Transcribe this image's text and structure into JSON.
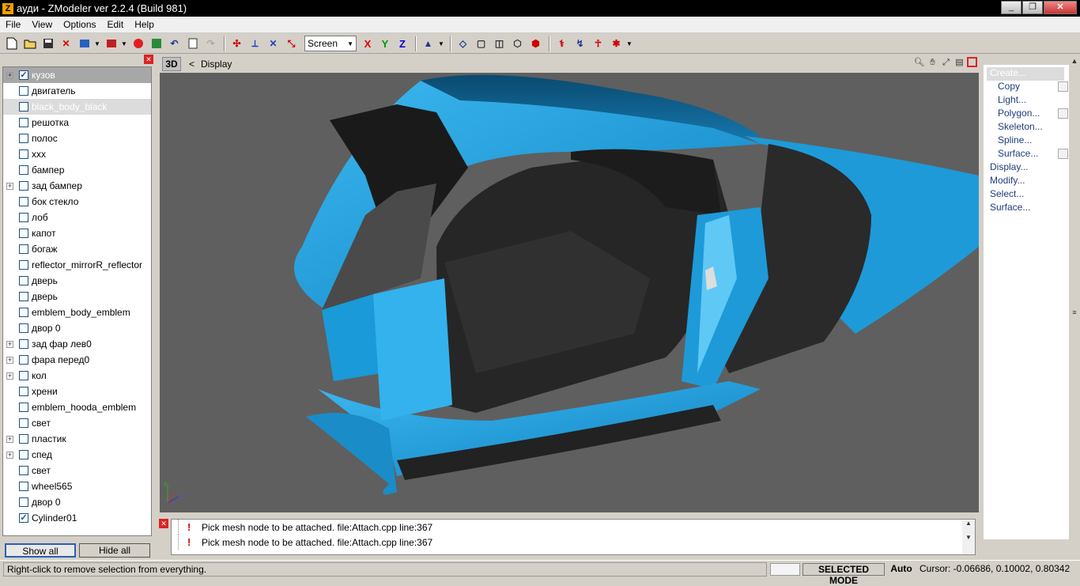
{
  "window": {
    "title": "ауди - ZModeler ver 2.2.4 (Build 981)",
    "app_icon": "Z"
  },
  "menu": [
    "File",
    "View",
    "Options",
    "Edit",
    "Help"
  ],
  "toolbar": {
    "view_mode": "Screen",
    "axis_x": "X",
    "axis_y": "Y",
    "axis_z": "Z"
  },
  "tree": {
    "items": [
      {
        "label": "кузов",
        "expandable": true,
        "checked": true,
        "state": "selected"
      },
      {
        "label": "двигатель",
        "expandable": false,
        "checked": false,
        "state": ""
      },
      {
        "label": "black_body_black",
        "expandable": false,
        "checked": false,
        "state": "highlight"
      },
      {
        "label": "решотка",
        "expandable": false,
        "checked": false,
        "state": ""
      },
      {
        "label": "полос",
        "expandable": false,
        "checked": false,
        "state": ""
      },
      {
        "label": "xxx",
        "expandable": false,
        "checked": false,
        "state": ""
      },
      {
        "label": "бампер",
        "expandable": false,
        "checked": false,
        "state": ""
      },
      {
        "label": "зад бампер",
        "expandable": true,
        "checked": false,
        "state": ""
      },
      {
        "label": "бок стекло",
        "expandable": false,
        "checked": false,
        "state": ""
      },
      {
        "label": "лоб",
        "expandable": false,
        "checked": false,
        "state": ""
      },
      {
        "label": "капот",
        "expandable": false,
        "checked": false,
        "state": ""
      },
      {
        "label": "богаж",
        "expandable": false,
        "checked": false,
        "state": ""
      },
      {
        "label": "reflector_mirrorR_reflector",
        "expandable": false,
        "checked": false,
        "state": ""
      },
      {
        "label": "дверь",
        "expandable": false,
        "checked": false,
        "state": ""
      },
      {
        "label": "дверь",
        "expandable": false,
        "checked": false,
        "state": ""
      },
      {
        "label": "emblem_body_emblem",
        "expandable": false,
        "checked": false,
        "state": ""
      },
      {
        "label": "двор 0",
        "expandable": false,
        "checked": false,
        "state": ""
      },
      {
        "label": "зад фар лев0",
        "expandable": true,
        "checked": false,
        "state": ""
      },
      {
        "label": "фара перед0",
        "expandable": true,
        "checked": false,
        "state": ""
      },
      {
        "label": "кол",
        "expandable": true,
        "checked": false,
        "state": ""
      },
      {
        "label": "хрени",
        "expandable": false,
        "checked": false,
        "state": ""
      },
      {
        "label": "emblem_hooda_emblem",
        "expandable": false,
        "checked": false,
        "state": ""
      },
      {
        "label": "свет",
        "expandable": false,
        "checked": false,
        "state": ""
      },
      {
        "label": "пластик",
        "expandable": true,
        "checked": false,
        "state": ""
      },
      {
        "label": "спед",
        "expandable": true,
        "checked": false,
        "state": ""
      },
      {
        "label": "свет",
        "expandable": false,
        "checked": false,
        "state": ""
      },
      {
        "label": "wheel565",
        "expandable": false,
        "checked": false,
        "state": ""
      },
      {
        "label": "двор 0",
        "expandable": false,
        "checked": false,
        "state": ""
      },
      {
        "label": "Cylinder01",
        "expandable": false,
        "checked": true,
        "state": ""
      }
    ],
    "show_all": "Show all",
    "hide_all": "Hide all"
  },
  "viewport": {
    "mode": "3D",
    "chevron": "<",
    "label": "Display",
    "axis_labels": {
      "y": "y",
      "z": "z"
    }
  },
  "log": [
    "Pick mesh node to be attached. file:Attach.cpp line:367",
    "Pick mesh node to be attached. file:Attach.cpp line:367"
  ],
  "commands": [
    {
      "label": "Create...",
      "indent": 0,
      "selected": true,
      "box": false
    },
    {
      "label": "Copy",
      "indent": 1,
      "selected": false,
      "box": true
    },
    {
      "label": "Light...",
      "indent": 1,
      "selected": false,
      "box": false
    },
    {
      "label": "Polygon...",
      "indent": 1,
      "selected": false,
      "box": true
    },
    {
      "label": "Skeleton...",
      "indent": 1,
      "selected": false,
      "box": false
    },
    {
      "label": "Spline...",
      "indent": 1,
      "selected": false,
      "box": false
    },
    {
      "label": "Surface...",
      "indent": 1,
      "selected": false,
      "box": true
    },
    {
      "label": "Display...",
      "indent": 0,
      "selected": false,
      "box": false
    },
    {
      "label": "Modify...",
      "indent": 0,
      "selected": false,
      "box": false
    },
    {
      "label": "Select...",
      "indent": 0,
      "selected": false,
      "box": false
    },
    {
      "label": "Surface...",
      "indent": 0,
      "selected": false,
      "box": false
    }
  ],
  "status": {
    "hint": "Right-click to remove selection from everything.",
    "mode": "SELECTED MODE",
    "auto": "Auto",
    "cursor": "Cursor: -0.06686, 0.10002, 0.80342"
  },
  "colors": {
    "body_blue": "#1ea0e0",
    "body_dark": "#0c5f8e",
    "interior": "#262626",
    "viewport_bg": "#5f5f5f"
  }
}
